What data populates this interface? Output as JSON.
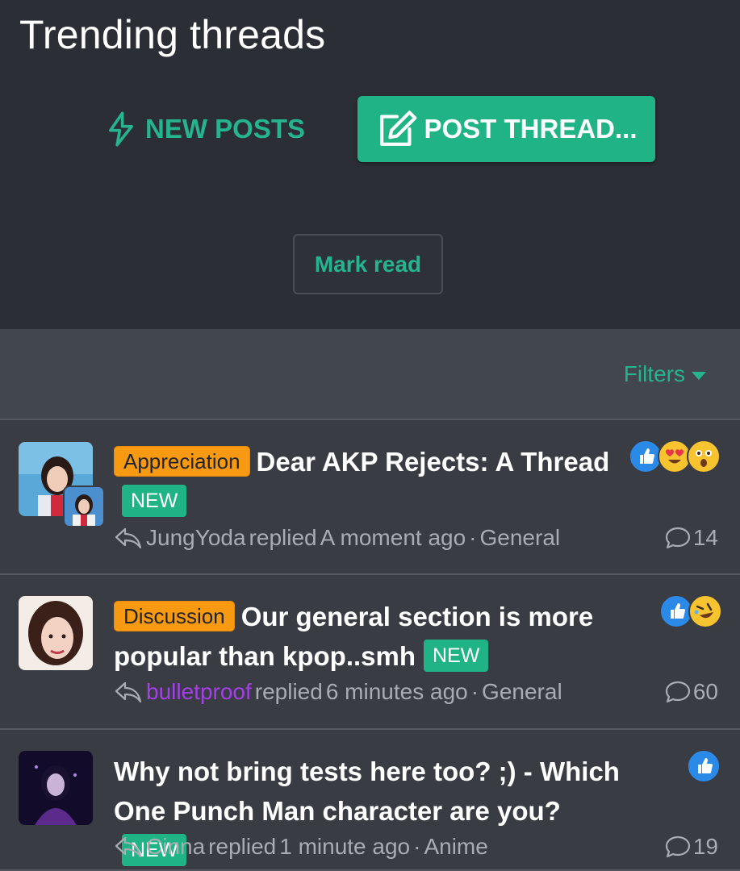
{
  "header": {
    "title": "Trending threads",
    "new_posts_label": "NEW POSTS",
    "post_thread_label": "POST THREAD...",
    "mark_read_label": "Mark read"
  },
  "filters": {
    "label": "Filters"
  },
  "threads": [
    {
      "prefix": "Appreciation",
      "title": "Dear AKP Rejects: A Thread",
      "badge": "NEW",
      "user": "JungYoda",
      "action": "replied",
      "time": "A moment ago",
      "separator": "·",
      "forum": "General",
      "replies": "14",
      "reactions": [
        "like",
        "love",
        "wow"
      ]
    },
    {
      "prefix": "Discussion",
      "title": "Our general section is more popular than kpop..smh",
      "badge": "NEW",
      "user": "bulletproof",
      "action": "replied",
      "time": "6 minutes ago",
      "separator": "·",
      "forum": "General",
      "replies": "60",
      "reactions": [
        "like",
        "haha"
      ]
    },
    {
      "prefix": "",
      "title": "Why not bring tests here too? ;) - Which One Punch Man character are you?",
      "badge": "NEW",
      "user": "Cinna",
      "action": "replied",
      "time": "1 minute ago",
      "separator": "·",
      "forum": "Anime",
      "replies": "19",
      "reactions": [
        "like"
      ]
    }
  ],
  "colors": {
    "accent": "#1fb385",
    "prefix_orange": "#f79a12",
    "background": "#2b2e34",
    "row_background": "#393c43",
    "username_purple": "#a340e6"
  }
}
